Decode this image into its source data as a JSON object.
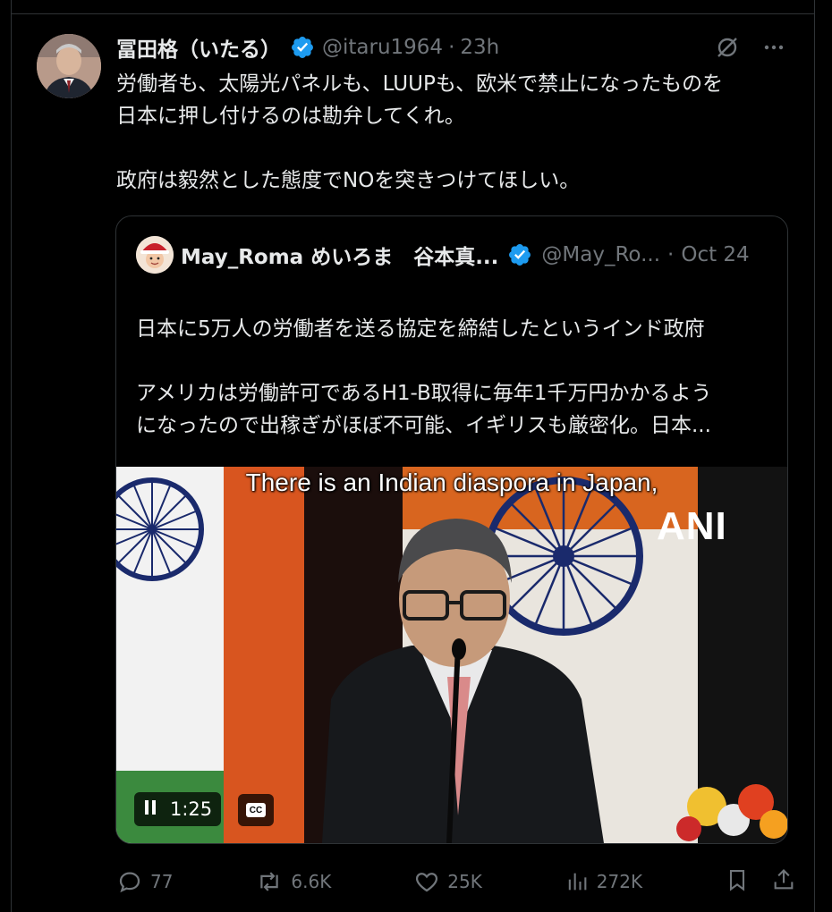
{
  "tweet": {
    "author_name": "冨田格（いたる）",
    "handle": "@itaru1964",
    "separator": "·",
    "time": "23h",
    "text": "労働者も、太陽光パネルも、LUUPも、欧米で禁止になったものを\n日本に押し付けるのは勘弁してくれ。\n\n政府は毅然とした態度でNOを突きつけてほしい。",
    "icons": {
      "grok": "grok-icon",
      "more": "more-icon",
      "verified": "verified-badge-icon"
    }
  },
  "quote": {
    "author_name": "May_Roma めいろま　谷本真...",
    "handle": "@May_Ro...",
    "separator": "·",
    "time": "Oct 24",
    "text": "日本に5万人の労働者を送る協定を締結したというインド政府\n\nアメリカは労働許可であるH1-B取得に毎年1千万円かかるよう\nになったので出稼ぎがほぼ不可能、イギリスも厳密化。日本...",
    "video": {
      "caption": "There is an Indian diaspora in Japan,",
      "watermark": "ANI",
      "time": "1:25",
      "cc_label": "CC"
    }
  },
  "actions": {
    "replies": "77",
    "reposts": "6.6K",
    "likes": "25K",
    "views": "272K"
  },
  "colors": {
    "background": "#000000",
    "text": "#e7e9ea",
    "muted": "#71767b",
    "border": "#2f3336",
    "verified": "#1d9bf0"
  }
}
